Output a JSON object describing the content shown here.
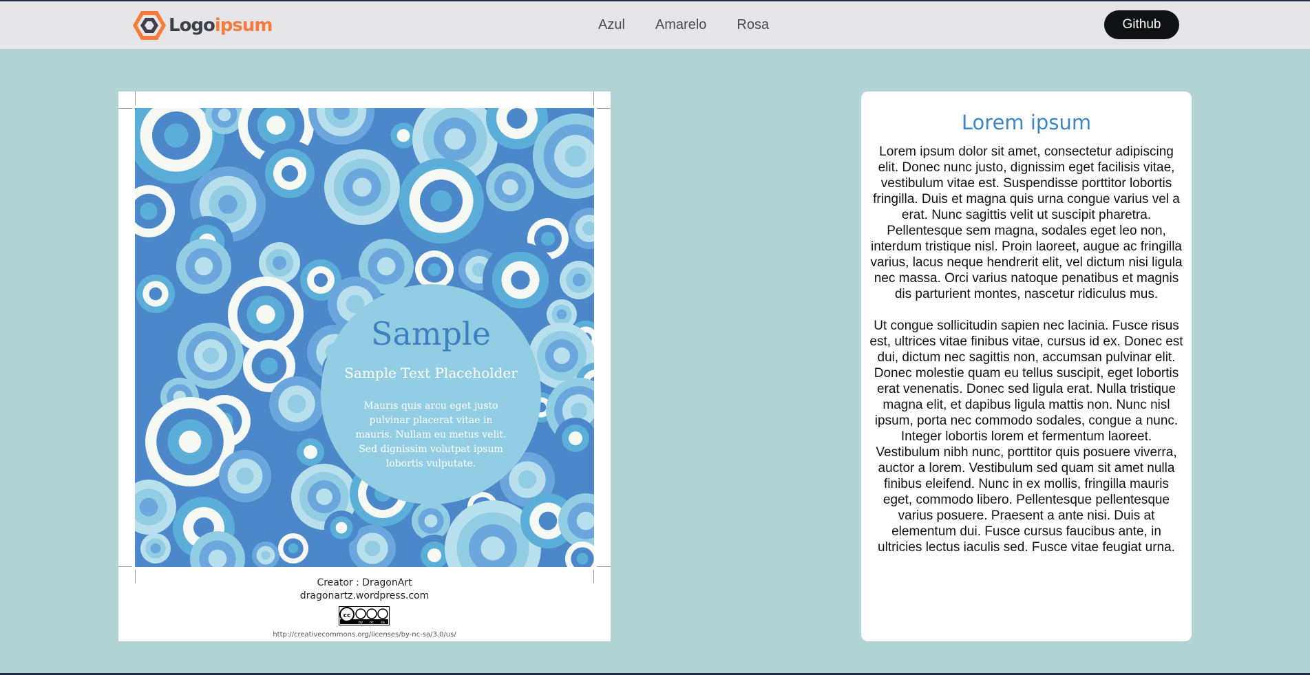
{
  "header": {
    "logo_primary": "Logo",
    "logo_accent": "ipsum",
    "nav": [
      "Azul",
      "Amarelo",
      "Rosa"
    ],
    "github_label": "Github"
  },
  "poster": {
    "title": "Sample",
    "subtitle": "Sample Text Placeholder",
    "body_lines": [
      "Mauris quis arcu eget justo",
      "pulvinar placerat vitae in",
      "mauris. Nullam eu metus velit.",
      "Sed dignissim volutpat ipsum",
      "lobortis vulputate."
    ],
    "creator": "Creator : DragonArt",
    "site": "dragonartz.wordpress.com",
    "license_url": "http://creativecommons.org/licenses/by-nc-sa/3.0/us/",
    "license_badge": [
      "by",
      "nc",
      "sa"
    ]
  },
  "card": {
    "title": "Lorem ipsum",
    "paragraph_1": "Lorem ipsum dolor sit amet, consectetur adipiscing elit. Donec nunc justo, dignissim eget facilisis vitae, vestibulum vitae est. Suspendisse porttitor lobortis fringilla. Duis et magna quis urna congue varius vel a erat. Nunc sagittis velit ut suscipit pharetra. Pellentesque sem magna, sodales eget leo non, interdum tristique nisl. Proin laoreet, augue ac fringilla varius, lacus neque hendrerit elit, vel dictum nisi ligula nec massa. Orci varius natoque penatibus et magnis dis parturient montes, nascetur ridiculus mus.",
    "paragraph_2": "Ut congue sollicitudin sapien nec lacinia. Fusce risus est, ultrices vitae finibus vitae, cursus id ex. Donec est dui, dictum nec sagittis non, accumsan pulvinar elit. Donec molestie quam eu tellus suscipit, eget lobortis erat venenatis. Donec sed ligula erat. Nulla tristique magna elit, et dapibus ligula mattis non. Nunc nisl ipsum, porta nec commodo sodales, congue a nunc. Integer lobortis lorem et fermentum laoreet. Vestibulum nibh nunc, porttitor quis posuere viverra, auctor a lorem. Vestibulum sed quam sit amet nulla finibus eleifend. Nunc in ex mollis, fringilla mauris eget, commodo libero. Pellentesque pellentesque varius posuere. Praesent a ante nisi. Duis at elementum dui. Fusce cursus faucibus ante, in ultricies lectus iaculis sed. Fusce vitae feugiat urna."
  },
  "colors": {
    "page_bg": "#b3d4d5",
    "header_bg": "#e6e6e8",
    "logo_accent": "#f47b3a",
    "card_title": "#3b86c6",
    "poster_bg_blue": "#4b87c9",
    "poster_center_circle": "#93cde3"
  }
}
